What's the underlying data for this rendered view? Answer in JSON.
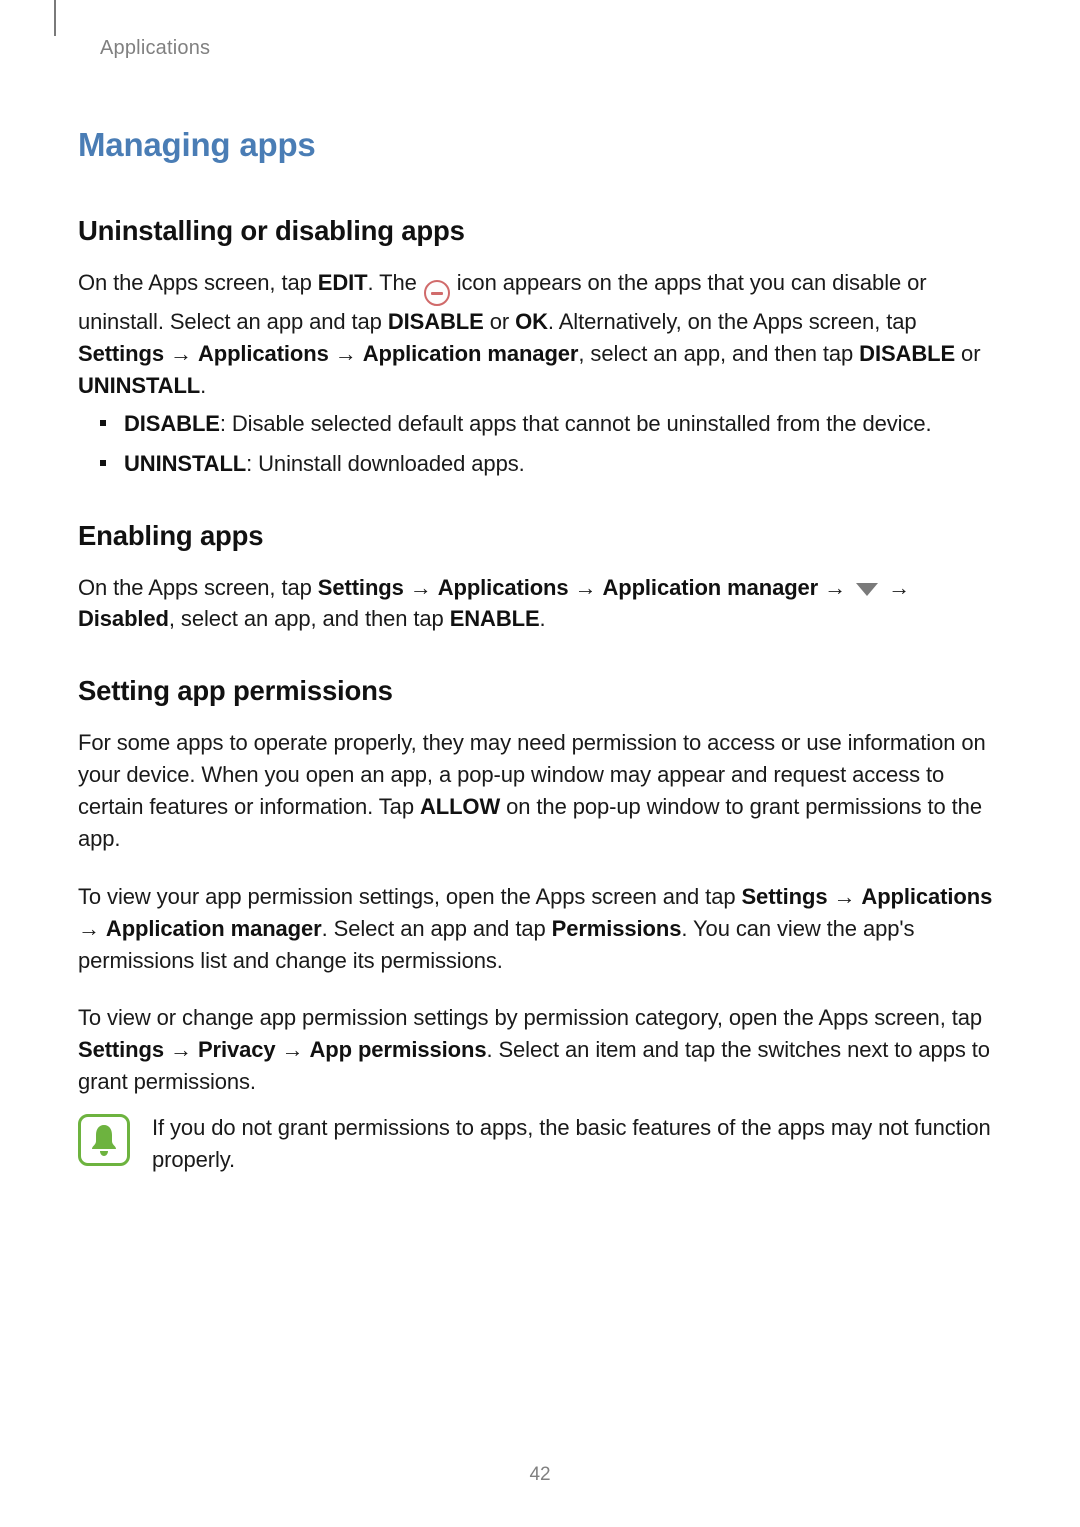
{
  "header": {
    "breadcrumb": "Applications"
  },
  "title": "Managing apps",
  "sections": {
    "uninstall": {
      "heading": "Uninstalling or disabling apps",
      "p1_pre": "On the Apps screen, tap ",
      "p1_edit": "EDIT",
      "p1_mid1": ". The ",
      "p1_mid2": " icon appears on the apps that you can disable or uninstall. Select an app and tap ",
      "p1_disable": "DISABLE",
      "p1_or": " or ",
      "p1_ok": "OK",
      "p1_mid3": ". Alternatively, on the Apps screen, tap ",
      "p1_settings": "Settings",
      "arrow": " → ",
      "p1_applications": "Applications",
      "p1_appmgr": "Application manager",
      "p1_tail": ", select an app, and then tap ",
      "p1_disable2": "DISABLE",
      "p1_or2": " or ",
      "p1_uninstall": "UNINSTALL",
      "p1_period": ".",
      "bullets": [
        {
          "strong": "DISABLE",
          "text": ": Disable selected default apps that cannot be uninstalled from the device."
        },
        {
          "strong": "UNINSTALL",
          "text": ": Uninstall downloaded apps."
        }
      ]
    },
    "enable": {
      "heading": "Enabling apps",
      "p_pre": "On the Apps screen, tap ",
      "p_settings": "Settings",
      "p_applications": "Applications",
      "p_appmgr": "Application manager",
      "p_tail1": " → ",
      "p_disabled": "Disabled",
      "p_tail2": ", select an app, and then tap ",
      "p_enable": "ENABLE",
      "p_period": "."
    },
    "permissions": {
      "heading": "Setting app permissions",
      "p1": "For some apps to operate properly, they may need permission to access or use information on your device. When you open an app, a pop-up window may appear and request access to certain features or information. Tap ",
      "p1_allow": "ALLOW",
      "p1_tail": " on the pop-up window to grant permissions to the app.",
      "p2_pre": "To view your app permission settings, open the Apps screen and tap ",
      "p2_settings": "Settings",
      "p2_applications": "Applications",
      "p2_appmgr": "Application manager",
      "p2_mid": ". Select an app and tap ",
      "p2_perm": "Permissions",
      "p2_tail": ". You can view the app's permissions list and change its permissions.",
      "p3_pre": "To view or change app permission settings by permission category, open the Apps screen, tap ",
      "p3_settings": "Settings",
      "p3_privacy": "Privacy",
      "p3_appperm": "App permissions",
      "p3_tail": ". Select an item and tap the switches next to apps to grant permissions.",
      "note": "If you do not grant permissions to apps, the basic features of the apps may not function properly."
    }
  },
  "page_number": "42"
}
